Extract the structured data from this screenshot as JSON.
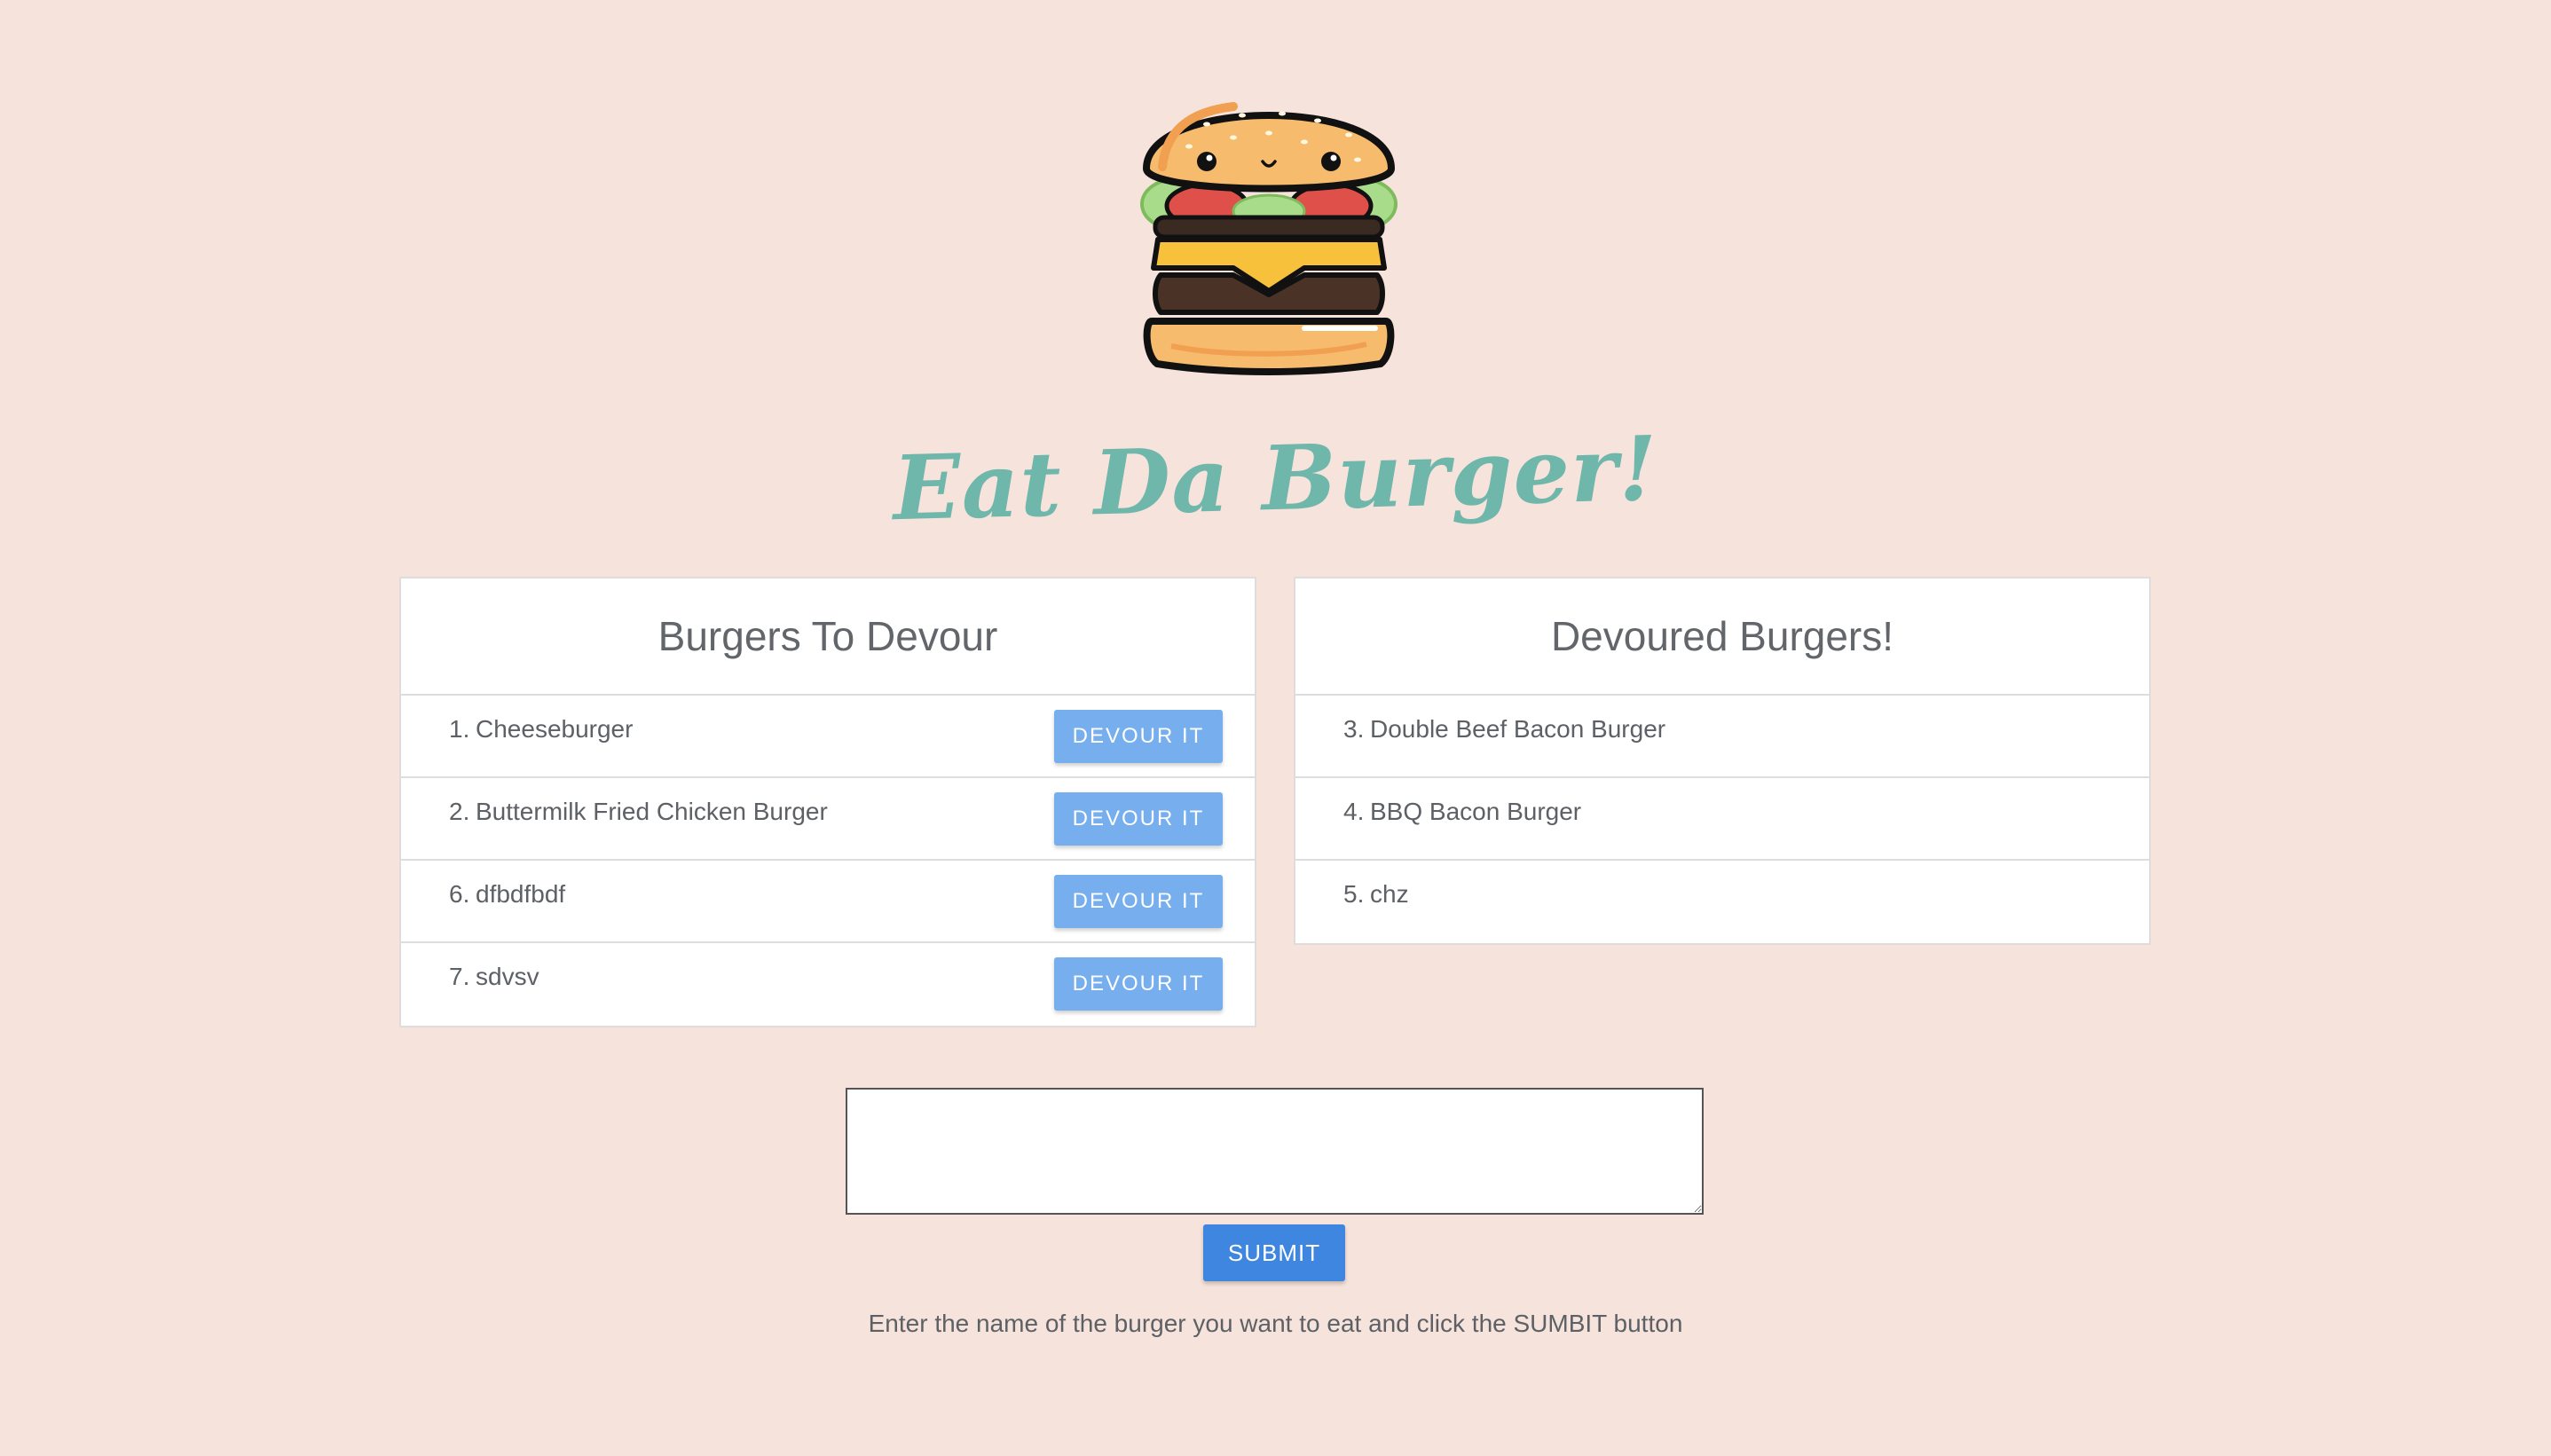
{
  "header": {
    "logo_icon": "burger-logo-icon",
    "title": "Eat Da Burger!"
  },
  "to_devour": {
    "title": "Burgers To Devour",
    "button_label": "DEVOUR IT",
    "items": [
      {
        "num": "1.",
        "name": "Cheeseburger"
      },
      {
        "num": "2.",
        "name": "Buttermilk Fried Chicken Burger"
      },
      {
        "num": "6.",
        "name": "dfbdfbdf"
      },
      {
        "num": "7.",
        "name": "sdvsv"
      }
    ]
  },
  "devoured": {
    "title": "Devoured Burgers!",
    "items": [
      {
        "num": "3.",
        "name": "Double Beef Bacon Burger"
      },
      {
        "num": "4.",
        "name": "BBQ Bacon Burger"
      },
      {
        "num": "5.",
        "name": "chz"
      }
    ]
  },
  "form": {
    "input_value": "",
    "submit_label": "SUBMIT",
    "hint": "Enter the name of the burger you want to eat and click the SUMBIT button"
  },
  "colors": {
    "background": "#f6e3db",
    "title": "#6fb6ab",
    "devour_button": "#76aeee",
    "submit_button": "#3f86e0"
  }
}
